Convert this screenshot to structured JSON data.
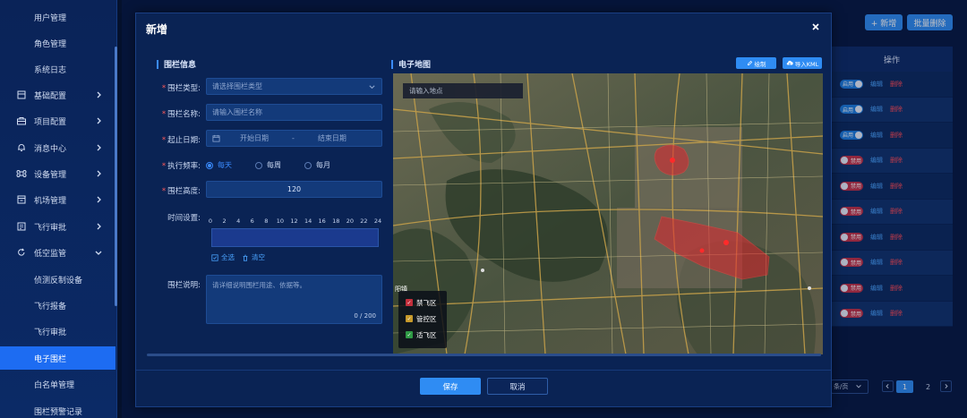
{
  "sidebar": {
    "items": [
      {
        "label": "用户管理",
        "level": "sub"
      },
      {
        "label": "角色管理",
        "level": "sub"
      },
      {
        "label": "系统日志",
        "level": "sub"
      },
      {
        "label": "基础配置",
        "level": "top",
        "icon": "settings-icon",
        "chevron": "right"
      },
      {
        "label": "项目配置",
        "level": "top",
        "icon": "briefcase-icon",
        "chevron": "right"
      },
      {
        "label": "消息中心",
        "level": "top",
        "icon": "bell-icon",
        "chevron": "right"
      },
      {
        "label": "设备管理",
        "level": "top",
        "icon": "command-icon",
        "chevron": "right"
      },
      {
        "label": "机场管理",
        "level": "top",
        "icon": "hangar-icon",
        "chevron": "right"
      },
      {
        "label": "飞行审批",
        "level": "top",
        "icon": "list-icon",
        "chevron": "right"
      },
      {
        "label": "低空监管",
        "level": "top",
        "icon": "refresh-icon",
        "chevron": "down"
      },
      {
        "label": "侦测反制设备",
        "level": "sub"
      },
      {
        "label": "飞行报备",
        "level": "sub"
      },
      {
        "label": "飞行审批",
        "level": "sub"
      },
      {
        "label": "电子围栏",
        "level": "sub",
        "active": true
      },
      {
        "label": "白名单管理",
        "level": "sub"
      },
      {
        "label": "围栏预警记录",
        "level": "sub"
      }
    ]
  },
  "background": {
    "add_label": "+ 新增",
    "batch_delete_label": "批量删除",
    "table_header": "操作",
    "rows": [
      {
        "toggle": "启用",
        "state": "on",
        "edit": "编辑",
        "delete": "删除"
      },
      {
        "toggle": "启用",
        "state": "on",
        "edit": "编辑",
        "delete": "删除"
      },
      {
        "toggle": "启用",
        "state": "on",
        "edit": "编辑",
        "delete": "删除"
      },
      {
        "toggle": "禁用",
        "state": "off",
        "edit": "编辑",
        "delete": "删除"
      },
      {
        "toggle": "禁用",
        "state": "off",
        "edit": "编辑",
        "delete": "删除"
      },
      {
        "toggle": "禁用",
        "state": "off",
        "edit": "编辑",
        "delete": "删除"
      },
      {
        "toggle": "禁用",
        "state": "off",
        "edit": "编辑",
        "delete": "删除"
      },
      {
        "toggle": "禁用",
        "state": "off",
        "edit": "编辑",
        "delete": "删除"
      },
      {
        "toggle": "禁用",
        "state": "off",
        "edit": "编辑",
        "delete": "删除"
      },
      {
        "toggle": "禁用",
        "state": "off",
        "edit": "编辑",
        "delete": "删除"
      }
    ],
    "page_size_label": "条/页",
    "pages": [
      "1",
      "2"
    ],
    "current_page": "1"
  },
  "modal": {
    "title": "新增",
    "close_glyph": "×",
    "fence_info_title": "围栏信息",
    "map_title": "电子地图",
    "fields": {
      "type_label": "围栏类型:",
      "type_placeholder": "请选择围栏类型",
      "name_label": "围栏名称:",
      "name_placeholder": "请输入围栏名称",
      "date_label": "起止日期:",
      "date_start_placeholder": "开始日期",
      "date_sep": "-",
      "date_end_placeholder": "结束日期",
      "freq_label": "执行频率:",
      "freq_options": [
        {
          "label": "每天",
          "selected": true
        },
        {
          "label": "每周",
          "selected": false
        },
        {
          "label": "每月",
          "selected": false
        }
      ],
      "height_label": "围栏高度:",
      "height_value": "120",
      "time_label": "时间设置:",
      "time_ticks": [
        "0",
        "2",
        "4",
        "6",
        "8",
        "10",
        "12",
        "14",
        "16",
        "18",
        "20",
        "22",
        "24"
      ],
      "select_all_label": "全选",
      "clear_label": "清空",
      "desc_label": "围栏说明:",
      "desc_placeholder": "请详细说明围栏用途、依据等。",
      "desc_counter": "0 / 200"
    },
    "map": {
      "draw_label": "绘制",
      "import_label": "导入KML",
      "search_placeholder": "请输入地点",
      "place_label": "阳镇",
      "legend": [
        {
          "label": "禁飞区",
          "color": "#c22f3b"
        },
        {
          "label": "管控区",
          "color": "#c79a2a"
        },
        {
          "label": "适飞区",
          "color": "#2f9a45"
        }
      ]
    },
    "save_label": "保存",
    "cancel_label": "取消"
  }
}
